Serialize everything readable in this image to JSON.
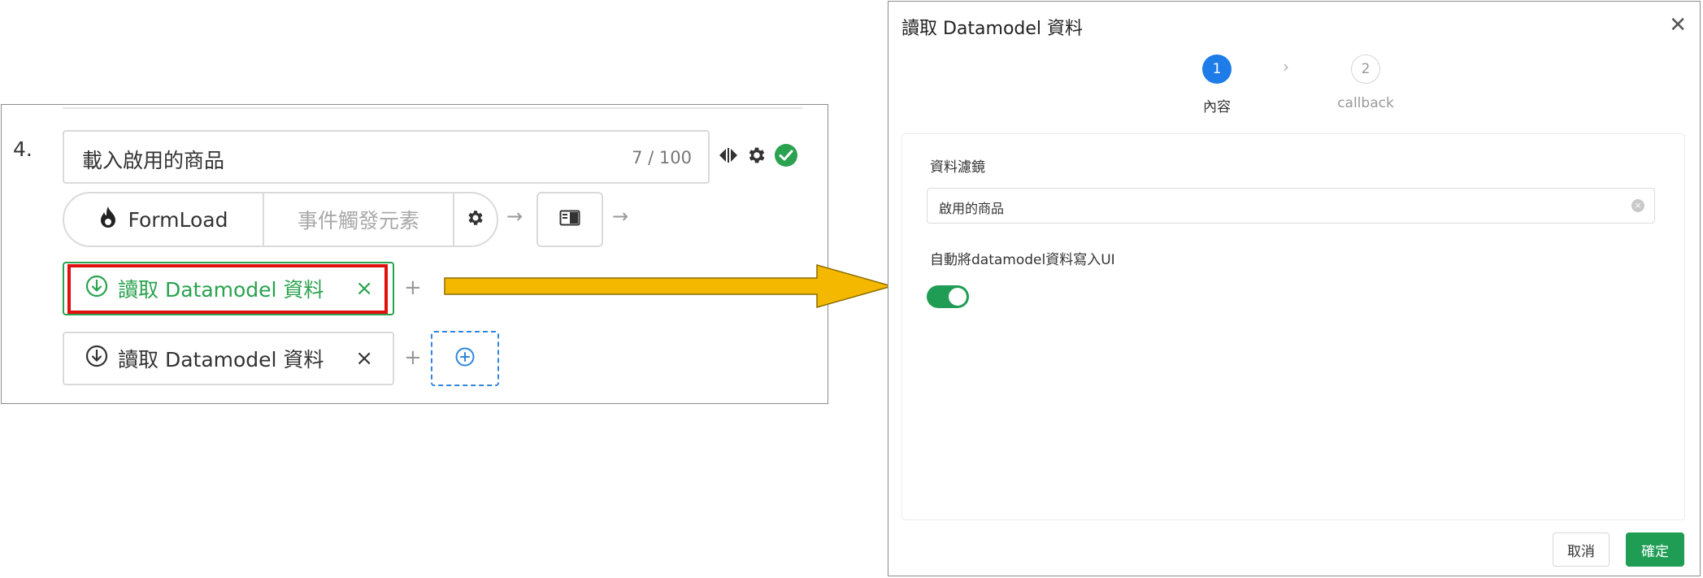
{
  "editor": {
    "step_number": "4.",
    "name_value": "載入啟用的商品",
    "name_count": "7 / 100",
    "trigger_label": "FormLoad",
    "trigger_element_placeholder": "事件觸發元素",
    "arrow_glyph": "→",
    "actions": [
      {
        "label": "讀取 Datamodel 資料",
        "state": "selected"
      },
      {
        "label": "讀取 Datamodel 資料",
        "state": "default"
      }
    ],
    "close_glyph": "×",
    "plus_glyph": "+",
    "colors": {
      "selected": "#2aa24f",
      "highlight": "#e11010",
      "add_border": "#2f86e0",
      "arrow": "#f5b800"
    }
  },
  "dialog": {
    "title": "讀取 Datamodel 資料",
    "close_glyph": "✕",
    "steps": [
      {
        "number": "1",
        "label": "內容",
        "state": "current"
      },
      {
        "number": "2",
        "label": "callback",
        "state": "pending"
      }
    ],
    "step_separator": "›",
    "filter": {
      "label": "資料濾鏡",
      "value": "啟用的商品"
    },
    "auto_write": {
      "label": "自動將datamodel資料寫入UI",
      "enabled": true
    },
    "buttons": {
      "cancel": "取消",
      "ok": "確定"
    },
    "colors": {
      "step_active": "#1e7ce8",
      "toggle_on": "#1f9d55",
      "ok_button": "#1f9d55"
    }
  }
}
